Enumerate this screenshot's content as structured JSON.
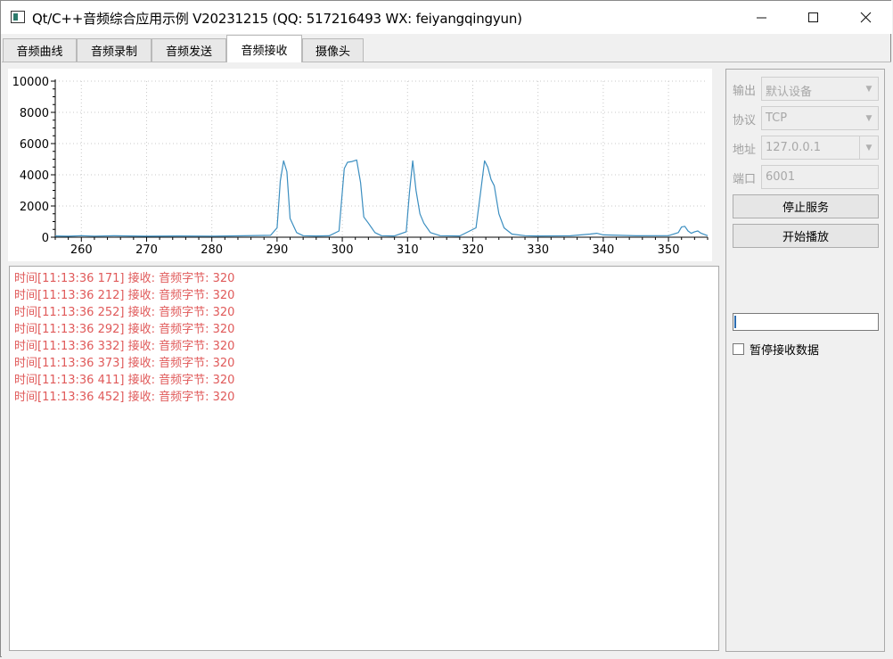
{
  "window": {
    "title": "Qt/C++音频综合应用示例 V20231215 (QQ: 517216493 WX: feiyangqingyun)"
  },
  "tabs": [
    {
      "label": "音频曲线",
      "active": false
    },
    {
      "label": "音频录制",
      "active": false
    },
    {
      "label": "音频发送",
      "active": false
    },
    {
      "label": "音频接收",
      "active": true
    },
    {
      "label": "摄像头",
      "active": false
    }
  ],
  "chart_data": {
    "type": "line",
    "xlim": [
      256,
      356
    ],
    "ylim": [
      0,
      10000
    ],
    "x_ticks": [
      260,
      270,
      280,
      290,
      300,
      310,
      320,
      330,
      340,
      350
    ],
    "y_ticks": [
      0,
      2000,
      4000,
      6000,
      8000,
      10000
    ],
    "grid": true,
    "line_color": "#3b8ec0",
    "series": [
      {
        "x": [
          256,
          258,
          260,
          262,
          265,
          270,
          275,
          280,
          285,
          289,
          290,
          290.5,
          291,
          291.5,
          292,
          293,
          294,
          296,
          298,
          299.5,
          300.3,
          300.8,
          301.5,
          302.2,
          302.8,
          303.3,
          304,
          305,
          306,
          308,
          309.8,
          310.3,
          310.8,
          311.3,
          311.9,
          312.5,
          313.5,
          315,
          318,
          320.5,
          321.2,
          321.8,
          322.3,
          322.8,
          323.3,
          324,
          324.8,
          326,
          328,
          330,
          335,
          338,
          339,
          340,
          345,
          350,
          351.5,
          352,
          352.5,
          353,
          353.5,
          354,
          354.5,
          355,
          356
        ],
        "y": [
          80,
          60,
          100,
          70,
          90,
          60,
          80,
          70,
          90,
          120,
          600,
          3600,
          4900,
          4200,
          1200,
          300,
          100,
          80,
          90,
          400,
          4400,
          4800,
          4850,
          4950,
          3500,
          1300,
          900,
          300,
          100,
          80,
          350,
          2900,
          4900,
          3000,
          1500,
          900,
          300,
          100,
          80,
          600,
          2900,
          4900,
          4500,
          3700,
          3300,
          1500,
          600,
          200,
          100,
          80,
          90,
          200,
          250,
          150,
          90,
          100,
          300,
          650,
          700,
          400,
          250,
          350,
          400,
          250,
          100
        ]
      }
    ]
  },
  "log": {
    "lines": [
      "时间[11:13:36 171] 接收: 音频字节: 320",
      "时间[11:13:36 212] 接收: 音频字节: 320",
      "时间[11:13:36 252] 接收: 音频字节: 320",
      "时间[11:13:36 292] 接收: 音频字节: 320",
      "时间[11:13:36 332] 接收: 音频字节: 320",
      "时间[11:13:36 373] 接收: 音频字节: 320",
      "时间[11:13:36 411] 接收: 音频字节: 320",
      "时间[11:13:36 452] 接收: 音频字节: 320"
    ]
  },
  "side": {
    "output_label": "输出",
    "output_value": "默认设备",
    "protocol_label": "协议",
    "protocol_value": "TCP",
    "address_label": "地址",
    "address_value": "127.0.0.1",
    "port_label": "端口",
    "port_value": "6001",
    "stop_button": "停止服务",
    "play_button": "开始播放",
    "pause_checkbox": "暂停接收数据",
    "pause_checked": false
  }
}
